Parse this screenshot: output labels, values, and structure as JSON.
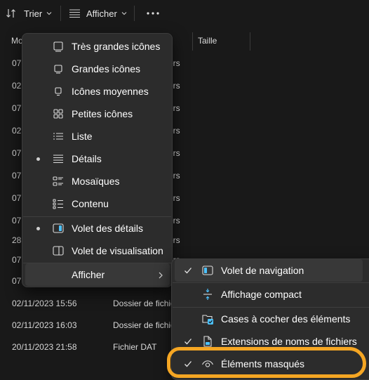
{
  "toolbar": {
    "sort_label": "Trier",
    "view_label": "Afficher",
    "sort_icon": "sort-arrows-icon",
    "view_icon": "view-lines-icon",
    "more_icon": "more-ellipsis-icon"
  },
  "columns": [
    "Mo",
    "Taille"
  ],
  "rows": [
    {
      "date": "07",
      "type": "ers"
    },
    {
      "date": "02",
      "type": "ers"
    },
    {
      "date": "07",
      "type": "ers"
    },
    {
      "date": "02",
      "type": "ers"
    },
    {
      "date": "07",
      "type": "ers"
    },
    {
      "date": "07",
      "type": "ers"
    },
    {
      "date": "07",
      "type": "ers"
    },
    {
      "date": "07",
      "type": "ers"
    },
    {
      "date": "28",
      "type": "ers"
    },
    {
      "date": "07",
      "type": "ers"
    },
    {
      "date": "07",
      "type": ""
    },
    {
      "date": "02/11/2023 15:56",
      "type": "Dossier de fichiers"
    },
    {
      "date": "02/11/2023 16:03",
      "type": "Dossier de fichiers"
    },
    {
      "date": "20/11/2023 21:58",
      "type": "Fichier DAT"
    }
  ],
  "menu": {
    "items": [
      {
        "label": "Très grandes icônes",
        "icon": "extra-large-icons-icon",
        "selected": false
      },
      {
        "label": "Grandes icônes",
        "icon": "large-icons-icon",
        "selected": false
      },
      {
        "label": "Icônes moyennes",
        "icon": "medium-icons-icon",
        "selected": false
      },
      {
        "label": "Petites icônes",
        "icon": "small-icons-icon",
        "selected": false
      },
      {
        "label": "Liste",
        "icon": "list-icon",
        "selected": false
      },
      {
        "label": "Détails",
        "icon": "details-icon",
        "selected": true
      },
      {
        "label": "Mosaïques",
        "icon": "tiles-icon",
        "selected": false
      },
      {
        "label": "Contenu",
        "icon": "content-icon",
        "selected": false
      }
    ],
    "panes": [
      {
        "label": "Volet des détails",
        "icon": "details-pane-icon",
        "selected": true
      },
      {
        "label": "Volet de visualisation",
        "icon": "preview-pane-icon",
        "selected": false
      }
    ],
    "show": {
      "label": "Afficher",
      "icon": "chevron-right-icon"
    }
  },
  "submenu": {
    "items": [
      {
        "label": "Volet de navigation",
        "icon": "navigation-pane-icon",
        "checked": true
      },
      {
        "label": "Affichage compact",
        "icon": "compact-view-icon",
        "checked": false
      },
      {
        "label": "Cases à cocher des éléments",
        "icon": "item-checkboxes-icon",
        "checked": false
      },
      {
        "label": "Extensions de noms de fichiers",
        "icon": "file-extension-icon",
        "checked": true
      },
      {
        "label": "Éléments masqués",
        "icon": "hidden-items-eye-icon",
        "checked": true
      }
    ]
  },
  "colors": {
    "background": "#191919",
    "menu_background": "#2c2c2c",
    "hover": "#383838",
    "text": "#ffffff",
    "highlight": "#f5a623",
    "accent_blue": "#4cc2ff"
  }
}
